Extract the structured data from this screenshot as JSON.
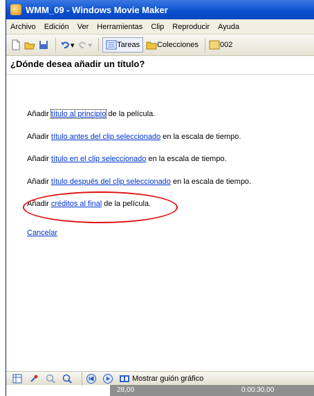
{
  "window": {
    "title": "WMM_09 - Windows Movie Maker"
  },
  "menu": [
    "Archivo",
    "Edición",
    "Ver",
    "Herramientas",
    "Clip",
    "Reproducir",
    "Ayuda"
  ],
  "toolbar": {
    "tasks_label": "Tareas",
    "collections_label": "Colecciones",
    "collection_value": "002"
  },
  "page": {
    "heading": "¿Dónde desea añadir un título?",
    "options": [
      {
        "prefix": "Añadir ",
        "link": "título al principio",
        "suffix": " de la película."
      },
      {
        "prefix": "Añadir ",
        "link": "título antes del clip seleccionado",
        "suffix": " en la escala de tiempo."
      },
      {
        "prefix": "Añadir ",
        "link": "título en el clip seleccionado",
        "suffix": " en la escala de tiempo."
      },
      {
        "prefix": "Añadir ",
        "link": "título después del clip seleccionado",
        "suffix": " en la escala de tiempo."
      },
      {
        "prefix": "Añadir ",
        "link": "créditos al final",
        "suffix": " de la película."
      }
    ],
    "cancel": "Cancelar"
  },
  "storyboard": {
    "show_label": "Mostrar guión gráfico"
  },
  "timeline": {
    "left_time": "28,00",
    "right_time": "0:00:30,00"
  },
  "colors": {
    "title_bar": "#0a4fd0",
    "link": "#0033cc",
    "highlight": "#e01010"
  }
}
